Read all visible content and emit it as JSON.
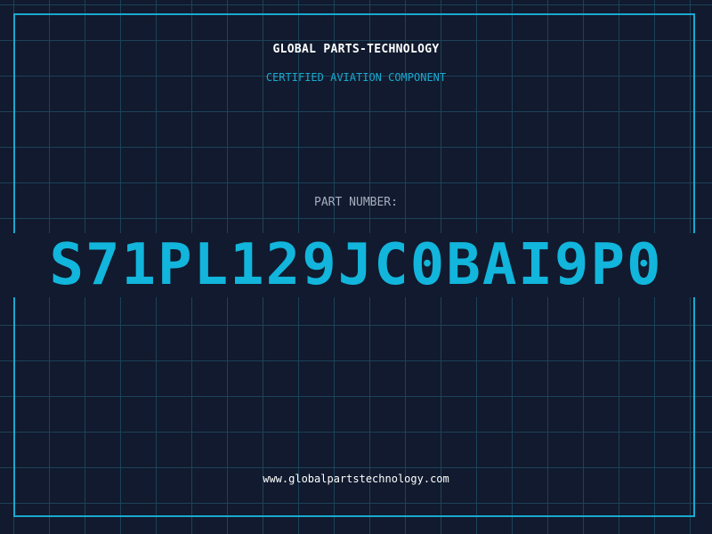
{
  "header": {
    "company": "GLOBAL PARTS-TECHNOLOGY",
    "subtitle": "CERTIFIED AVIATION COMPONENT"
  },
  "part": {
    "label": "PART NUMBER:",
    "number": "S71PL129JC0BAI9P0"
  },
  "footer": {
    "website": "www.globalpartstechnology.com"
  },
  "colors": {
    "background": "#111a2e",
    "grid": "#1d4258",
    "accent": "#1aa9cf",
    "part_number": "#12b5dc",
    "label": "#a7adbf",
    "text": "#ffffff"
  }
}
